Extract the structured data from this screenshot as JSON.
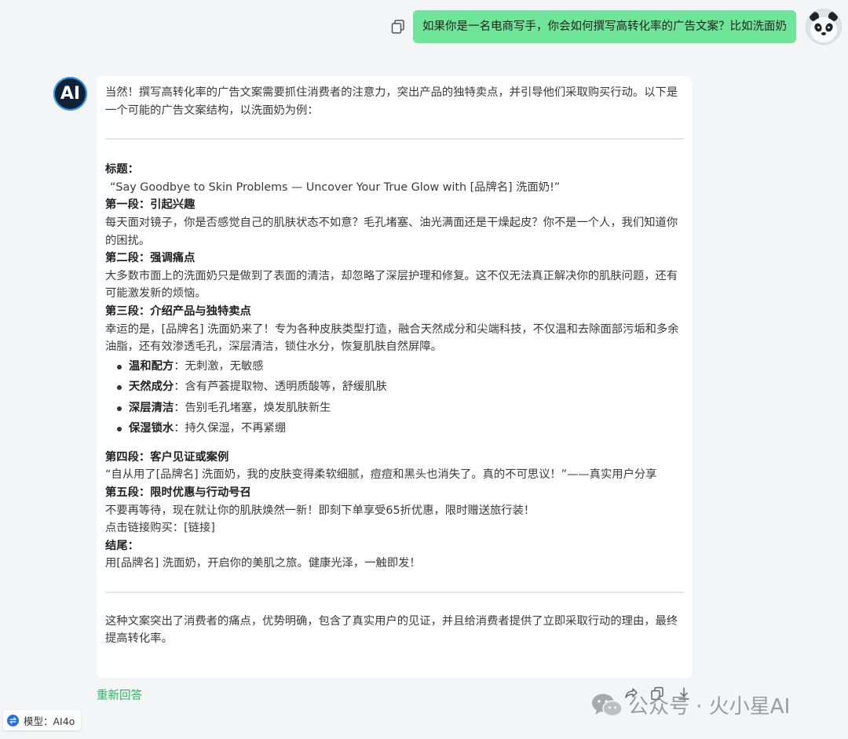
{
  "user_message": {
    "text": "如果你是一名电商写手，你会如何撰写高转化率的广告文案？比如洗面奶"
  },
  "ai": {
    "avatar_label": "AI",
    "intro": "当然！撰写高转化率的广告文案需要抓住消费者的注意力，突出产品的独特卖点，并引导他们采取购买行动。以下是一个可能的广告文案结构，以洗面奶为例：",
    "title_heading": "标题：",
    "title_text": "“Say Goodbye to Skin Problems — Uncover Your True Glow with [品牌名] 洗面奶!”",
    "sec1_heading": "第一段：引起兴趣",
    "sec1_text": "每天面对镜子，你是否感觉自己的肌肤状态不如意？毛孔堵塞、油光满面还是干燥起皮？你不是一个人，我们知道你的困扰。",
    "sec2_heading": "第二段：强调痛点",
    "sec2_text": "大多数市面上的洗面奶只是做到了表面的清洁，却忽略了深层护理和修复。这不仅无法真正解决你的肌肤问题，还有可能激发新的烦恼。",
    "sec3_heading": "第三段：介绍产品与独特卖点",
    "sec3_text": "幸运的是，[品牌名] 洗面奶来了！专为各种皮肤类型打造，融合天然成分和尖端科技，不仅温和去除面部污垢和多余油脂，还有效渗透毛孔，深层清洁，锁住水分，恢复肌肤自然屏障。",
    "features": [
      {
        "name": "温和配方",
        "desc": "：无刺激，无敏感"
      },
      {
        "name": "天然成分",
        "desc": "：含有芦荟提取物、透明质酸等，舒缓肌肤"
      },
      {
        "name": "深层清洁",
        "desc": "：告别毛孔堵塞，焕发肌肤新生"
      },
      {
        "name": "保湿锁水",
        "desc": "：持久保湿，不再紧绷"
      }
    ],
    "sec4_heading": "第四段：客户见证或案例",
    "sec4_text": "“自从用了[品牌名] 洗面奶，我的皮肤变得柔软细腻，痘痘和黑头也消失了。真的不可思议！”——真实用户分享",
    "sec5_heading": "第五段：限时优惠与行动号召",
    "sec5_text1": "不要再等待，现在就让你的肌肤焕然一新！即刻下单享受65折优惠，限时赠送旅行装！",
    "sec5_text2": "点击链接购买：[链接]",
    "ending_heading": "结尾：",
    "ending_text": "用[品牌名] 洗面奶，开启你的美肌之旅。健康光泽，一触即发！",
    "summary": "这种文案突出了消费者的痛点，优势明确，包含了真实用户的见证，并且给消费者提供了立即采取行动的理由，最终提高转化率。"
  },
  "regenerate_label": "重新回答",
  "watermark_text": "公众号 · 火小星AI",
  "model_badge": "模型：AI4o",
  "colors": {
    "user_bubble": "#6fe59a",
    "accent_green": "#22b85a",
    "background": "#f4f5f7"
  },
  "icons": [
    "copy-icon",
    "panda-avatar",
    "ai-avatar",
    "share-icon",
    "copy-icon",
    "download-icon",
    "wechat-icon",
    "swap-icon"
  ]
}
